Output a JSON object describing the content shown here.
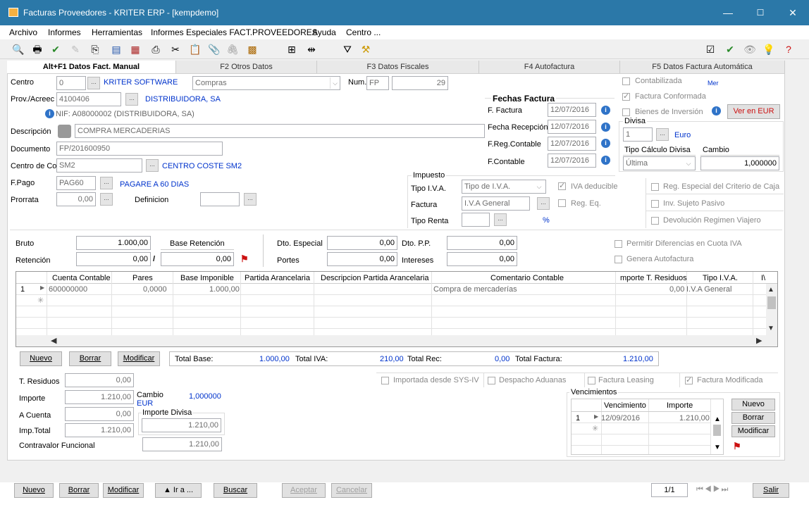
{
  "window": {
    "title": "Facturas Proveedores  - KRITER ERP - [kempdemo]",
    "min": "—",
    "max": "☐",
    "close": "✕"
  },
  "menu": [
    "Archivo",
    "Informes",
    "Herramientas",
    "Informes Especiales FACT.PROVEEDORES",
    "Ayuda",
    "Centro ..."
  ],
  "tabs": [
    "Alt+F1 Datos Fact. Manual",
    "F2 Otros Datos",
    "F3 Datos Fiscales",
    "F4 Autofactura",
    "F5 Datos Factura Automática"
  ],
  "form": {
    "centro_label": "Centro",
    "centro_value": "0",
    "centro_name": "KRITER SOFTWARE",
    "centro_type": "Compras",
    "num_label": "Num.",
    "num_series": "FP",
    "num_value": "29",
    "prov_label": "Prov./Acreec",
    "prov_value": "4100406",
    "prov_name": "DISTRIBUIDORA, SA",
    "nif_text": "NIF:  A08000002 (DISTRIBUIDORA, SA)",
    "desc_label": "Descripción",
    "desc_value": "COMPRA MERCADERIAS",
    "doc_label": "Documento",
    "doc_value": "FP/201600950",
    "cc_label": "Centro de Co",
    "cc_value": "SM2",
    "cc_name": "CENTRO COSTE SM2",
    "fpago_label": "F.Pago",
    "fpago_value": "PAG60",
    "fpago_name": "PAGARE A 60 DIAS",
    "prorrata_label": "Prorrata",
    "prorrata_value": "0,00",
    "definicion_label": "Definicion"
  },
  "fechas": {
    "title": "Fechas Factura",
    "f_factura_label": "F. Factura",
    "f_factura": "12/07/2016",
    "f_recep_label": "Fecha Recepción",
    "f_recep": "12/07/2016",
    "f_reg_label": "F.Reg.Contable",
    "f_reg": "12/07/2016",
    "f_cont_label": "F.Contable",
    "f_cont": "12/07/2016"
  },
  "right_checks": {
    "contabilizada": "Contabilizada",
    "mer": "Mer",
    "conformada": "Factura Conformada",
    "bienes": "Bienes de Inversión",
    "ver_eur": "Ver en EUR"
  },
  "divisa": {
    "title": "Divisa",
    "value": "1",
    "name": "Euro",
    "tipo_label": "Tipo Cálculo Divisa",
    "cambio_label": "Cambio",
    "tipo_value": "Última",
    "cambio_value": "1,000000"
  },
  "impuesto": {
    "title": "Impuesto",
    "tipo_iva_label": "Tipo I.V.A.",
    "tipo_iva_value": "Tipo de I.V.A.",
    "iva_deducible": "IVA deducible",
    "factura_label": "Factura",
    "factura_value": "I.V.A General",
    "reg_eq": "Reg. Eq.",
    "tipo_renta_label": "Tipo Renta",
    "percent": "%",
    "reg_especial": "Reg. Especial del Criterio de Caja",
    "inv_sujeto": "Inv. Sujeto Pasivo",
    "devolucion": "Devolución Regimen Viajero"
  },
  "totals_top": {
    "bruto_label": "Bruto",
    "bruto": "1.000,00",
    "base_ret_label": "Base Retención",
    "retencion_label": "Retención",
    "retencion": "0,00",
    "retencion_pct": "0,00",
    "dto_esp_label": "Dto. Especial",
    "dto_esp": "0,00",
    "dto_pp_label": "Dto. P.P.",
    "dto_pp": "0,00",
    "portes_label": "Portes",
    "portes": "0,00",
    "intereses_label": "Intereses",
    "intereses": "0,00",
    "permitir": "Permitir Diferencias en Cuota IVA",
    "genera_auto": "Genera Autofactura"
  },
  "grid": {
    "headers": [
      "Cuenta Contable",
      "Pares",
      "Base Imponible",
      "Partida Arancelaria",
      "Descripcion Partida Arancelaria",
      "Comentario Contable",
      "mporte T. Residuos",
      "Tipo I.V.A.",
      "I\\"
    ],
    "row": {
      "num": "1",
      "cuenta": "600000000",
      "pares": "0,0000",
      "base": "1.000,00",
      "comentario": "Compra de mercaderías",
      "residuos": "0,00",
      "tipo_iva": "I.V.A General"
    }
  },
  "grid_buttons": {
    "nuevo": "Nuevo",
    "borrar": "Borrar",
    "modificar": "Modificar"
  },
  "summary": {
    "total_base_label": "Total Base:",
    "total_base": "1.000,00",
    "total_iva_label": "Total IVA:",
    "total_iva": "210,00",
    "total_rec_label": "Total Rec:",
    "total_rec": "0,00",
    "total_fact_label": "Total Factura:",
    "total_fact": "1.210,00"
  },
  "bottom_left": {
    "residuos_label": "T. Residuos",
    "residuos": "0,00",
    "importe_label": "Importe",
    "importe": "1.210,00",
    "cambio_label": "Cambio",
    "cambio": "1,000000",
    "eur": "EUR",
    "acuenta_label": "A Cuenta",
    "acuenta": "0,00",
    "imp_divisa_label": "Importe Divisa",
    "imp_divisa": "1.210,00",
    "imptotal_label": "Imp.Total",
    "imptotal": "1.210,00",
    "contravalor_label": "Contravalor Funcional",
    "contravalor": "1.210,00"
  },
  "bottom_checks": {
    "importada": "Importada desde SYS-IV",
    "despacho": "Despacho Aduanas",
    "leasing": "Factura Leasing",
    "modificada": "Factura Modificada"
  },
  "vencimientos": {
    "title": "Vencimientos",
    "col_venc": "Vencimiento",
    "col_imp": "Importe",
    "row_num": "1",
    "row_venc": "12/09/2016",
    "row_imp": "1.210,00",
    "nuevo": "Nuevo",
    "borrar": "Borrar",
    "modificar": "Modificar"
  },
  "footer": {
    "nuevo": "Nuevo",
    "borrar": "Borrar",
    "modificar": "Modificar",
    "ira": "▲ Ir a ...",
    "buscar": "Buscar",
    "aceptar": "Aceptar",
    "cancelar": "Cancelar",
    "page": "1/1",
    "salir": "Salir"
  },
  "colors": {
    "titlebar": "#2b78a8",
    "link_blue": "#0033cc",
    "panel_bg": "#f0f0f0"
  }
}
